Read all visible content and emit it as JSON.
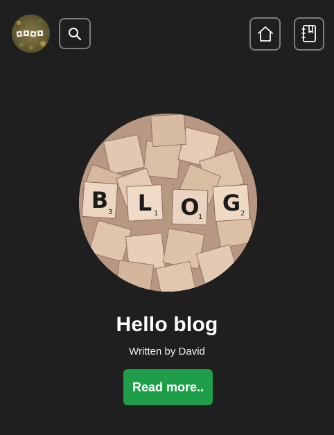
{
  "header": {
    "avatar_icon": "profile-avatar-icon",
    "search_icon": "search-icon",
    "home_icon": "home-icon",
    "blog_icon": "notebook-bookmark-icon"
  },
  "post": {
    "image_tiles": [
      "B",
      "L",
      "O",
      "G"
    ],
    "image_tile_scores": [
      "3",
      "1",
      "1",
      "2"
    ],
    "title": "Hello blog",
    "author": "Written by David",
    "read_more_label": "Read more.."
  },
  "colors": {
    "background": "#1f1f1f",
    "button_border": "#7a7d82",
    "accent_green": "#1e9e49",
    "text_white": "#ffffff"
  }
}
